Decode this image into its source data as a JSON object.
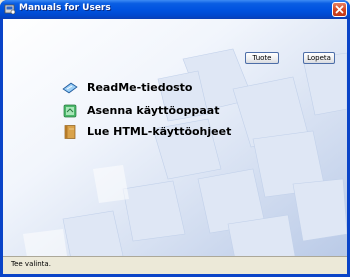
{
  "window": {
    "title": "Manuals for Users"
  },
  "toolbar": {
    "product_label": "Tuote",
    "exit_label": "Lopeta"
  },
  "menu": {
    "items": [
      {
        "label": "ReadMe-tiedosto",
        "icon": "readme-icon"
      },
      {
        "label": "Asenna käyttöoppaat",
        "icon": "install-icon"
      },
      {
        "label": "Lue HTML-käyttöohjeet",
        "icon": "html-manual-icon"
      }
    ]
  },
  "status": {
    "text": "Tee valinta."
  },
  "colors": {
    "titlebar": "#0053e0",
    "close_button": "#d2451f",
    "background_art": "#c9d7ef"
  }
}
